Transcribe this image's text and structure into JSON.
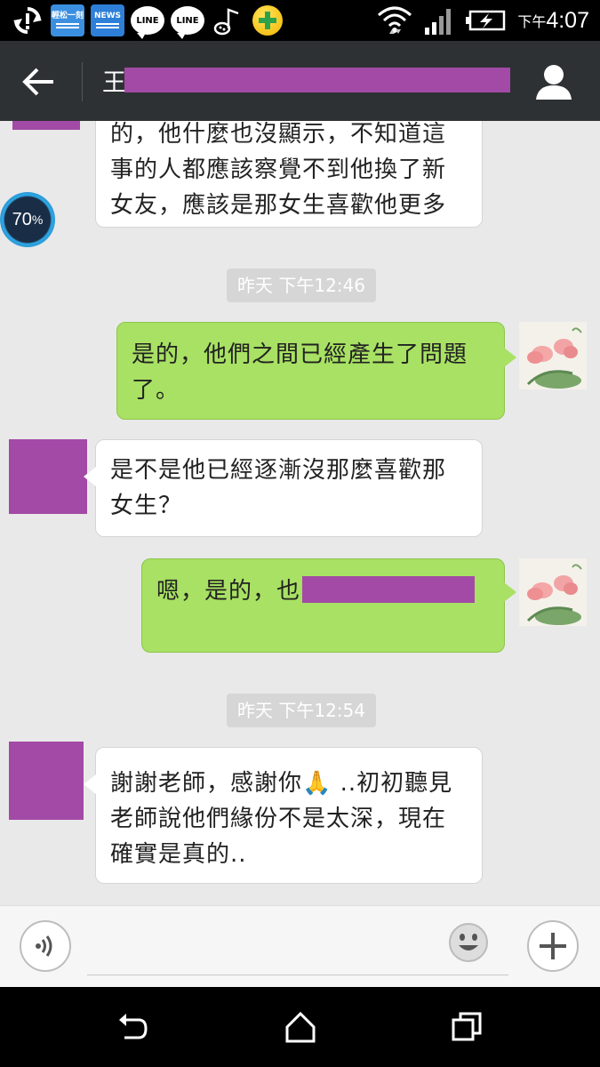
{
  "status_bar": {
    "apps": [
      {
        "icon": "sync-icon"
      },
      {
        "icon": "app-tile-icon",
        "label": "輕松一刻"
      },
      {
        "icon": "news-app-icon",
        "label": "NEWS"
      },
      {
        "icon": "line-app-icon",
        "label": "LINE"
      },
      {
        "icon": "line-app-icon",
        "label": "LINE"
      },
      {
        "icon": "music-note-icon"
      },
      {
        "icon": "plus-app-icon"
      }
    ],
    "time_prefix": "下午",
    "time": "4:07",
    "indicators": [
      "wifi-icon",
      "signal-icon",
      "battery-charging-icon"
    ]
  },
  "header": {
    "back_icon": "back-arrow-icon",
    "contact_name": "王",
    "profile_icon": "person-icon"
  },
  "chat": {
    "progress_badge": {
      "value": "70",
      "unit": "%"
    },
    "messages": [
      {
        "type": "incoming",
        "lines": [
          "的，他什麼也沒顯示，不知道這",
          "事的人都應該察覺不到他換了新",
          "女友，應該是那女生喜歡他更多"
        ]
      },
      {
        "type": "timestamp",
        "text": "昨天 下午12:46"
      },
      {
        "type": "outgoing",
        "lines": [
          "是的，他們之間已經產生了問題",
          "了。"
        ]
      },
      {
        "type": "incoming",
        "lines": [
          "是不是他已經逐漸沒那麼喜歡那",
          "女生？"
        ]
      },
      {
        "type": "outgoing",
        "lines": [
          "嗯，是的，也"
        ]
      },
      {
        "type": "timestamp",
        "text": "昨天 下午12:54"
      },
      {
        "type": "incoming",
        "lines": [
          "謝謝老師，感謝你",
          " ..初初聽見",
          "老師說他們緣份不是太深，現在",
          "確實是真的.."
        ],
        "emoji": "🙏"
      }
    ]
  },
  "input_bar": {
    "voice_icon": "voice-icon",
    "emoji_icon": "smiley-icon",
    "plus_icon": "plus-icon",
    "placeholder": ""
  },
  "nav_bar": {
    "buttons": [
      "back-nav-icon",
      "home-nav-icon",
      "recents-nav-icon"
    ]
  },
  "colors": {
    "outgoing_bubble": "#a8e163",
    "incoming_bubble": "#ffffff",
    "header_bg": "#2e3134",
    "redaction": "#a24aa5",
    "chat_bg": "#e9e9e9"
  }
}
